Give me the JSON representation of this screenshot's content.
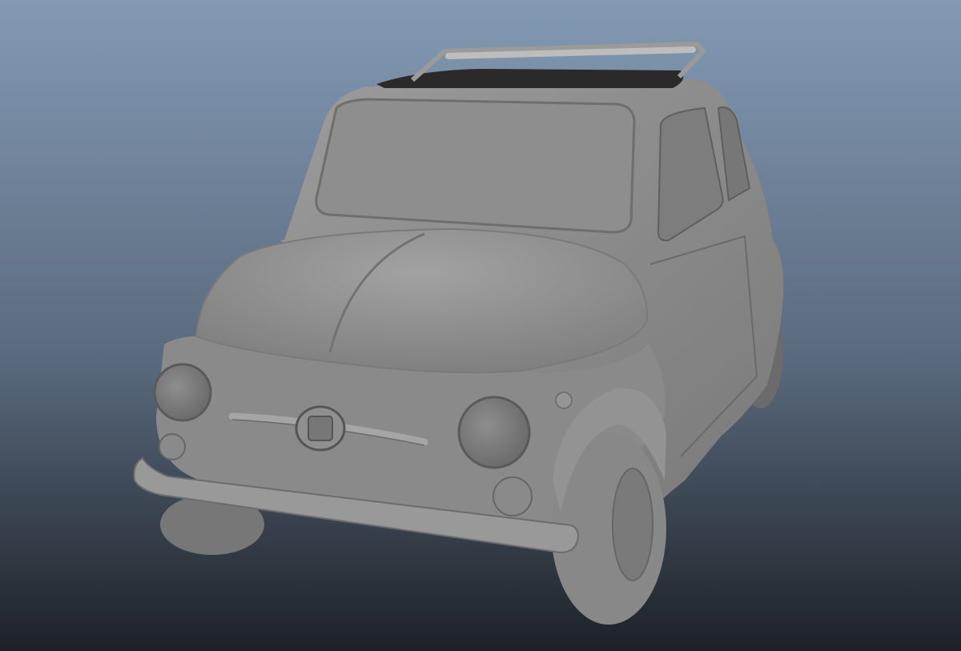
{
  "scene": {
    "background_top": "#8399b3",
    "background_bottom": "#1d2127",
    "model_color": "#8c8c8c",
    "model_shadow": "#5e5e5e",
    "model_highlight": "#a9a9a9"
  }
}
